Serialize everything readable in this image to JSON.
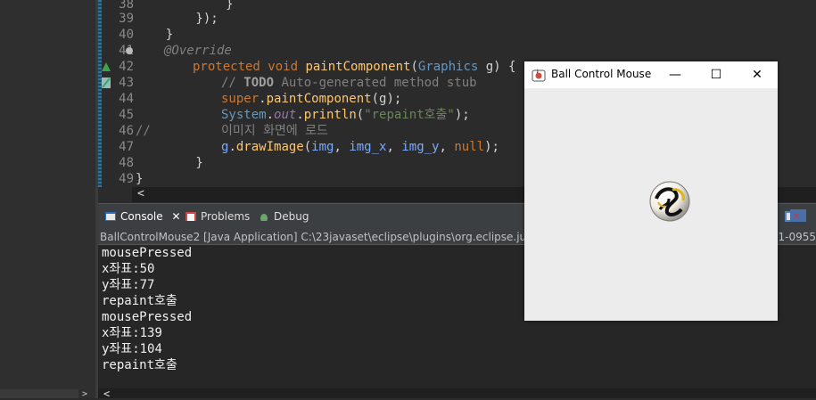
{
  "editor": {
    "lines": [
      {
        "num": "38",
        "text": "            }"
      },
      {
        "num": "39",
        "text": "        });"
      },
      {
        "num": "40",
        "text": "    }"
      },
      {
        "num": "41",
        "annotation": "@Override"
      },
      {
        "num": "42",
        "p1": "protected void ",
        "p2": "paintComponent",
        "p3": "(",
        "p4": "Graphics ",
        "p5": "g) {"
      },
      {
        "num": "43",
        "c1": "// ",
        "c2": "TODO",
        "c3": " Auto-generated method stub"
      },
      {
        "num": "44",
        "p1": "super",
        "p2": ".",
        "p3": "paintComponent",
        "p4": "(g);"
      },
      {
        "num": "45",
        "p1": "System",
        "p2": ".",
        "p3": "out",
        "p4": ".",
        "p5": "println",
        "p6": "(",
        "p7": "\"repaint호출\"",
        "p8": ");"
      },
      {
        "num": "46",
        "comment_prefix": "//",
        "comment_text": "이미지 화면에 로드"
      },
      {
        "num": "47",
        "p1": "g",
        "p2": ".",
        "p3": "drawImage",
        "p4": "(",
        "p5": "img",
        "p6": ", ",
        "p7": "img_x",
        "p8": ", ",
        "p9": "img_y",
        "p10": ", ",
        "p11": "null",
        "p12": ");"
      },
      {
        "num": "48",
        "text": "        }"
      },
      {
        "num": "49",
        "text": "}"
      }
    ],
    "hscroll_arrow": "<"
  },
  "tabs": {
    "console": "Console",
    "problems": "Problems",
    "debug": "Debug"
  },
  "console_info": "BallControlMouse2 [Java Application] C:\\23javaset\\eclipse\\plugins\\org.eclipse.justj.op",
  "console_info_right": "1-0955",
  "console_lines": [
    "mousePressed",
    "x좌표:50",
    "y좌표:77",
    "repaint호출",
    "mousePressed",
    "x좌표:139",
    "y좌표:104",
    "repaint호출"
  ],
  "console_bottom_arrow": "<",
  "window": {
    "title": "Ball Control Mouse",
    "minimize": "—",
    "maximize": "☐",
    "close": "✕"
  },
  "left_bottom_arrow": ">"
}
